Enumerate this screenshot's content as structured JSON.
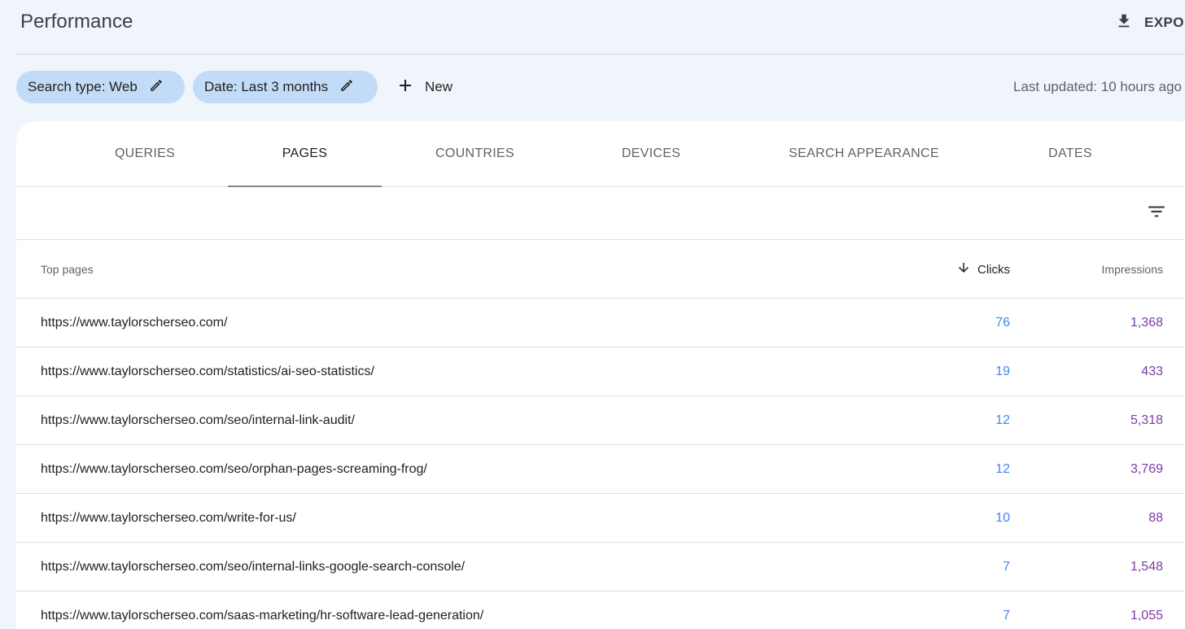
{
  "header": {
    "title": "Performance",
    "export_label": "EXPORT"
  },
  "filters": {
    "search_type": "Search type: Web",
    "date": "Date: Last 3 months",
    "new_label": "New",
    "last_updated": "Last updated: 10 hours ago"
  },
  "tabs": [
    {
      "label": "QUERIES",
      "active": false
    },
    {
      "label": "PAGES",
      "active": true
    },
    {
      "label": "COUNTRIES",
      "active": false
    },
    {
      "label": "DEVICES",
      "active": false
    },
    {
      "label": "SEARCH APPEARANCE",
      "active": false
    },
    {
      "label": "DATES",
      "active": false
    }
  ],
  "table": {
    "columns": {
      "page": "Top pages",
      "clicks": "Clicks",
      "impressions": "Impressions"
    },
    "rows": [
      {
        "page": "https://www.taylorscherseo.com/",
        "clicks": "76",
        "impressions": "1,368"
      },
      {
        "page": "https://www.taylorscherseo.com/statistics/ai-seo-statistics/",
        "clicks": "19",
        "impressions": "433"
      },
      {
        "page": "https://www.taylorscherseo.com/seo/internal-link-audit/",
        "clicks": "12",
        "impressions": "5,318"
      },
      {
        "page": "https://www.taylorscherseo.com/seo/orphan-pages-screaming-frog/",
        "clicks": "12",
        "impressions": "3,769"
      },
      {
        "page": "https://www.taylorscherseo.com/write-for-us/",
        "clicks": "10",
        "impressions": "88"
      },
      {
        "page": "https://www.taylorscherseo.com/seo/internal-links-google-search-console/",
        "clicks": "7",
        "impressions": "1,548"
      },
      {
        "page": "https://www.taylorscherseo.com/saas-marketing/hr-software-lead-generation/",
        "clicks": "7",
        "impressions": "1,055"
      }
    ]
  },
  "colors": {
    "clicks": "#4285f4",
    "impressions": "#7e3ba6",
    "chip_bg": "#c2dcf7",
    "page_bg": "#f0f4fb"
  },
  "icons": {
    "export": "download-icon",
    "edit": "pencil-icon",
    "new": "plus-icon",
    "filter": "filter-list-icon",
    "sort": "arrow-down-icon"
  }
}
